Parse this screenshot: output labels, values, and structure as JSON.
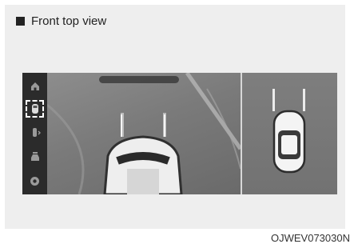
{
  "caption": {
    "title": "Front top view"
  },
  "sidebar": {
    "items": [
      {
        "icon": "home-icon",
        "active": false
      },
      {
        "icon": "front-top-view-icon",
        "active": true
      },
      {
        "icon": "side-view-icon",
        "active": false
      },
      {
        "icon": "rear-view-icon",
        "active": false
      },
      {
        "icon": "settings-icon",
        "active": false
      }
    ]
  },
  "footer": {
    "code": "OJWEV073030N"
  },
  "colors": {
    "screen_bg": "#6f6f6f",
    "sidebar_bg": "#2b2b2b",
    "guideline": "#f1f1f1"
  }
}
